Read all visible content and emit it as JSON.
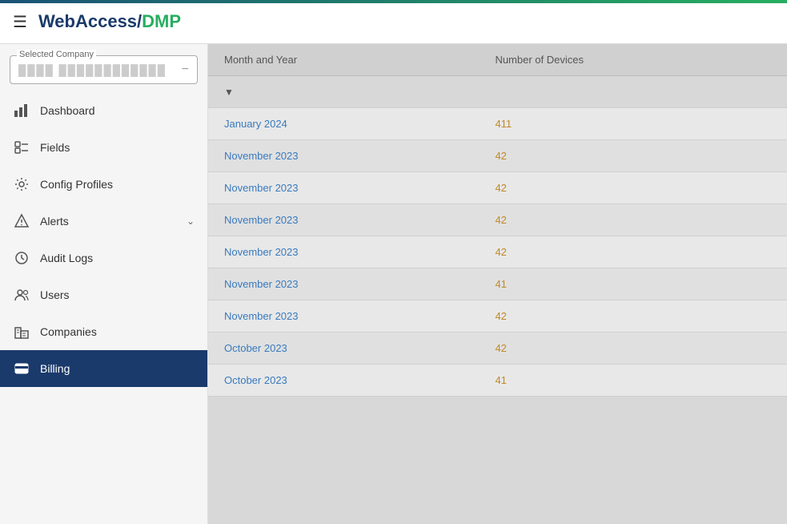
{
  "topbar": {
    "logo_web": "WebAccess",
    "logo_slash": "/",
    "logo_dmp": "DMP"
  },
  "sidebar": {
    "company_label": "Selected Company",
    "company_placeholder": "████ ████████████",
    "nav_items": [
      {
        "id": "dashboard",
        "label": "Dashboard",
        "icon": "bar-chart",
        "active": false,
        "has_arrow": false
      },
      {
        "id": "fields",
        "label": "Fields",
        "icon": "fields",
        "active": false,
        "has_arrow": false
      },
      {
        "id": "config-profiles",
        "label": "Config Profiles",
        "icon": "gear",
        "active": false,
        "has_arrow": false
      },
      {
        "id": "alerts",
        "label": "Alerts",
        "icon": "alert",
        "active": false,
        "has_arrow": true
      },
      {
        "id": "audit-logs",
        "label": "Audit Logs",
        "icon": "clock",
        "active": false,
        "has_arrow": false
      },
      {
        "id": "users",
        "label": "Users",
        "icon": "users",
        "active": false,
        "has_arrow": false
      },
      {
        "id": "companies",
        "label": "Companies",
        "icon": "companies",
        "active": false,
        "has_arrow": false
      },
      {
        "id": "billing",
        "label": "Billing",
        "icon": "billing",
        "active": true,
        "has_arrow": false
      }
    ]
  },
  "table": {
    "col1_header": "Month and Year",
    "col2_header": "Number of Devices",
    "rows": [
      {
        "month": "January 2024",
        "count": "411"
      },
      {
        "month": "November 2023",
        "count": "42"
      },
      {
        "month": "November 2023",
        "count": "42"
      },
      {
        "month": "November 2023",
        "count": "42"
      },
      {
        "month": "November 2023",
        "count": "42"
      },
      {
        "month": "November 2023",
        "count": "41"
      },
      {
        "month": "November 2023",
        "count": "42"
      },
      {
        "month": "October 2023",
        "count": "42"
      },
      {
        "month": "October 2023",
        "count": "41"
      }
    ]
  }
}
